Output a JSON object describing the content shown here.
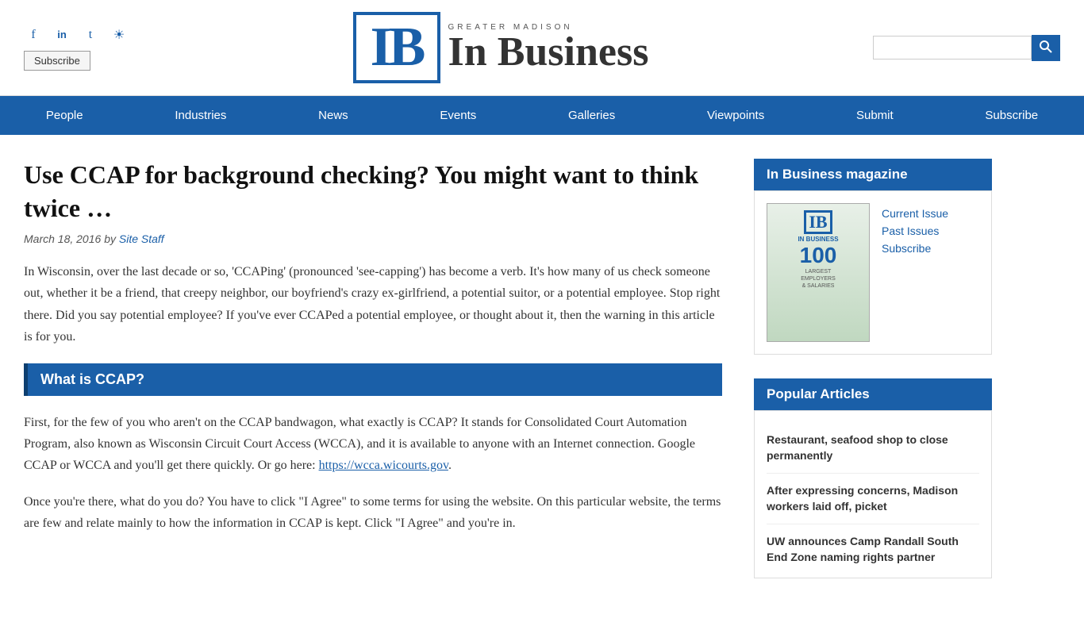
{
  "header": {
    "social_icons": [
      {
        "name": "facebook-icon",
        "symbol": "f"
      },
      {
        "name": "linkedin-icon",
        "symbol": "in"
      },
      {
        "name": "twitter-icon",
        "symbol": "t"
      },
      {
        "name": "instagram-icon",
        "symbol": "ig"
      }
    ],
    "subscribe_label": "Subscribe",
    "logo_greater": "Greater",
    "logo_madison": "Madison",
    "logo_ib": "IB",
    "logo_inbusiness": "In Business",
    "search_placeholder": ""
  },
  "nav": {
    "items": [
      {
        "label": "People",
        "href": "#"
      },
      {
        "label": "Industries",
        "href": "#"
      },
      {
        "label": "News",
        "href": "#"
      },
      {
        "label": "Events",
        "href": "#"
      },
      {
        "label": "Galleries",
        "href": "#"
      },
      {
        "label": "Viewpoints",
        "href": "#"
      },
      {
        "label": "Submit",
        "href": "#"
      },
      {
        "label": "Subscribe",
        "href": "#"
      }
    ]
  },
  "article": {
    "title": "Use CCAP for background checking? You might want to think twice …",
    "meta_date": "March 18, 2016",
    "meta_by": "by",
    "meta_author": "Site Staff",
    "body": [
      "In Wisconsin, over the last decade or so, 'CCAPing' (pronounced 'see-capping') has become a verb. It's how many of us check someone out, whether it be a friend, that creepy neighbor, our boyfriend's crazy ex-girlfriend, a potential suitor, or a potential employee. Stop right there. Did you say potential employee? If you've ever CCAPed a potential employee, or thought about it, then the warning in this article is for you.",
      "First, for the few of you who aren't on the CCAP bandwagon, what exactly is CCAP? It stands for Consolidated Court Automation Program, also known as Wisconsin Circuit Court Access (WCCA), and it is available to anyone with an Internet connection. Google CCAP or WCCA and you'll get there quickly. Or go here: https://wcca.wicourts.gov.",
      "Once you're there, what do you do? You have to click \"I Agree\" to some terms for using the website. On this particular website, the terms are few and relate mainly to how the information in CCAP is kept. Click \"I Agree\" and you're in."
    ],
    "section_header": "What is CCAP?",
    "ccap_link": "https://wcca.wicourts.gov"
  },
  "sidebar": {
    "magazine_title": "In Business magazine",
    "magazine_links": [
      {
        "label": "Current Issue",
        "href": "#"
      },
      {
        "label": "Past Issues",
        "href": "#"
      },
      {
        "label": "Subscribe",
        "href": "#"
      }
    ],
    "popular_title": "Popular Articles",
    "popular_articles": [
      {
        "title": "Restaurant, seafood shop to close permanently",
        "href": "#"
      },
      {
        "title": "After expressing concerns, Madison workers laid off, picket",
        "href": "#"
      },
      {
        "title": "UW announces Camp Randall South End Zone naming rights partner",
        "href": "#"
      }
    ]
  }
}
